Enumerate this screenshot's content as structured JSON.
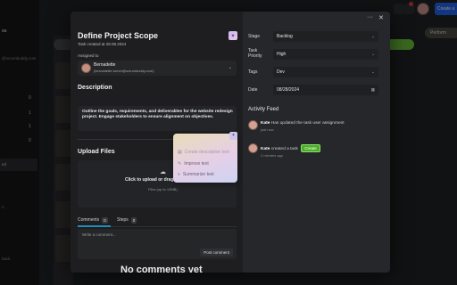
{
  "background": {
    "sidebar_fragments": [
      "ss",
      "ed",
      "n",
      "back"
    ],
    "sidebar_subtext": "@scrumbuddy.com",
    "counts": [
      "0",
      "1",
      "1",
      "0"
    ],
    "create_button": "Create a",
    "perform_pill": "Perform",
    "notification_count": "1"
  },
  "modal": {
    "title": "Define Project Scope",
    "created": "Task created at 28.08.2024",
    "assigned_label": "Assigned to",
    "assignee": {
      "name": "Bernadette",
      "email": "(bernadette.turner@scrumbuddy.com)"
    },
    "description_title": "Description",
    "description_text": "Outline the goals, requirements, and deliverables for the website redesign project. Engage stakeholders to ensure alignment on objectives.",
    "upload_title": "Upload Files",
    "upload_main": "Click to upload or drag and",
    "upload_sub": "Files (up to 12MB)",
    "ai_menu": {
      "items": [
        {
          "icon": "description-icon",
          "label": "Create description text"
        },
        {
          "icon": "sparkle-icon",
          "label": "Improve text"
        },
        {
          "icon": "summarize-icon",
          "label": "Summarize text"
        }
      ]
    },
    "tabs": [
      {
        "label": "Comments",
        "count": "0"
      },
      {
        "label": "Steps",
        "count": "0"
      }
    ],
    "comment_placeholder": "Write a comment...",
    "post_label": "Post comment",
    "no_comments": "No comments yet",
    "fields": [
      {
        "label": "Stage",
        "value": "Backlog"
      },
      {
        "label": "Task Priority",
        "value": "High"
      },
      {
        "label": "Tags",
        "value": "Dev"
      },
      {
        "label": "Date",
        "value": "08/28/2024"
      }
    ],
    "activity_title": "Activity Feed",
    "activity": [
      {
        "user": "Kate",
        "text": "Has updated the task user assignment",
        "time": "just now"
      },
      {
        "user": "Kate",
        "text": "created a task",
        "chip": "Create",
        "time": "2 minutes ago"
      }
    ]
  },
  "colors": {
    "accent_blue": "#2463eb",
    "tab_underline": "#1f8db8",
    "create_chip": "#4caf2b"
  }
}
